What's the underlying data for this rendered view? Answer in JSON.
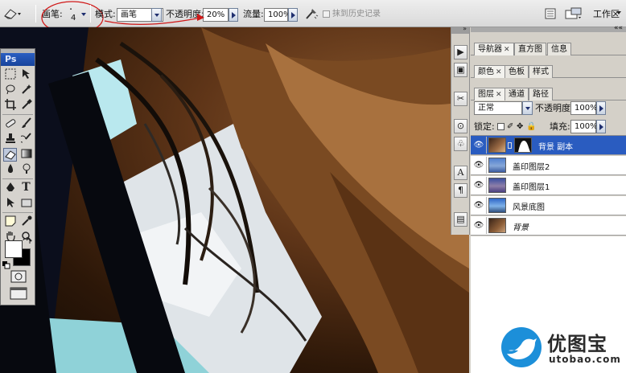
{
  "options_bar": {
    "brush_label": "画笔:",
    "brush_size": "4",
    "mode_label": "模式:",
    "mode_value": "画笔",
    "opacity_label": "不透明度:",
    "opacity_value": "20%",
    "flow_label": "流量:",
    "flow_value": "100%",
    "history_label": "抹到历史记录",
    "workspace_label": "工作区"
  },
  "toolbox": {
    "logo": "Ps",
    "type_tool": "T"
  },
  "panels": {
    "group1_tabs": [
      {
        "label": "导航器",
        "closable": true
      },
      {
        "label": "直方图",
        "closable": false
      },
      {
        "label": "信息",
        "closable": false
      }
    ],
    "group2_tabs": [
      {
        "label": "颜色",
        "closable": true
      },
      {
        "label": "色板",
        "closable": false
      },
      {
        "label": "样式",
        "closable": false
      }
    ],
    "layers_tabs": [
      {
        "label": "图层",
        "closable": true
      },
      {
        "label": "通道",
        "closable": false
      },
      {
        "label": "路径",
        "closable": false
      }
    ],
    "blend_mode": "正常",
    "opacity_label": "不透明度:",
    "opacity_value": "100%",
    "lock_label": "锁定:",
    "fill_label": "填充:",
    "fill_value": "100%",
    "layers": [
      {
        "name": "背景 副本",
        "selected": true,
        "has_mask": true,
        "italic": false
      },
      {
        "name": "盖印图层2",
        "selected": false,
        "has_mask": false,
        "italic": false
      },
      {
        "name": "盖印图层1",
        "selected": false,
        "has_mask": false,
        "italic": false
      },
      {
        "name": "风景底图",
        "selected": false,
        "has_mask": false,
        "italic": false
      },
      {
        "name": "背景",
        "selected": false,
        "has_mask": false,
        "italic": true
      }
    ]
  },
  "watermark": {
    "title": "优图宝",
    "url": "utobao.com"
  },
  "colors": {
    "selection": "#2a5cc0",
    "annotation": "#d01818",
    "logo_blue": "#1c8fd9"
  }
}
